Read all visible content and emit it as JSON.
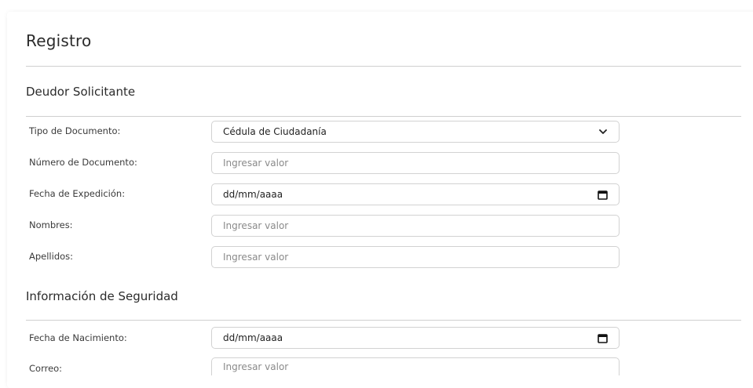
{
  "page": {
    "title": "Registro"
  },
  "sections": {
    "deudor": {
      "title": "Deudor Solicitante",
      "fields": {
        "tipo_documento": {
          "label": "Tipo de Documento:",
          "value": "Cédula de Ciudadanía",
          "icon": "chevron-down-icon"
        },
        "numero_documento": {
          "label": "Número de Documento:",
          "placeholder": "Ingresar valor"
        },
        "fecha_expedicion": {
          "label": "Fecha de Expedición:",
          "value": "dd/mm/aaaa",
          "icon": "calendar-icon"
        },
        "nombres": {
          "label": "Nombres:",
          "placeholder": "Ingresar valor"
        },
        "apellidos": {
          "label": "Apellidos:",
          "placeholder": "Ingresar valor"
        }
      }
    },
    "seguridad": {
      "title": "Información de Seguridad",
      "fields": {
        "fecha_nacimiento": {
          "label": "Fecha de Nacimiento:",
          "value": "dd/mm/aaaa",
          "icon": "calendar-icon"
        },
        "correo": {
          "label": "Correo:",
          "placeholder": "Ingresar valor"
        }
      }
    }
  },
  "colors": {
    "text": "#2b2b2b",
    "border": "#d2d2d2",
    "divider": "#cfcfcf",
    "placeholder": "#8a8a8a"
  }
}
